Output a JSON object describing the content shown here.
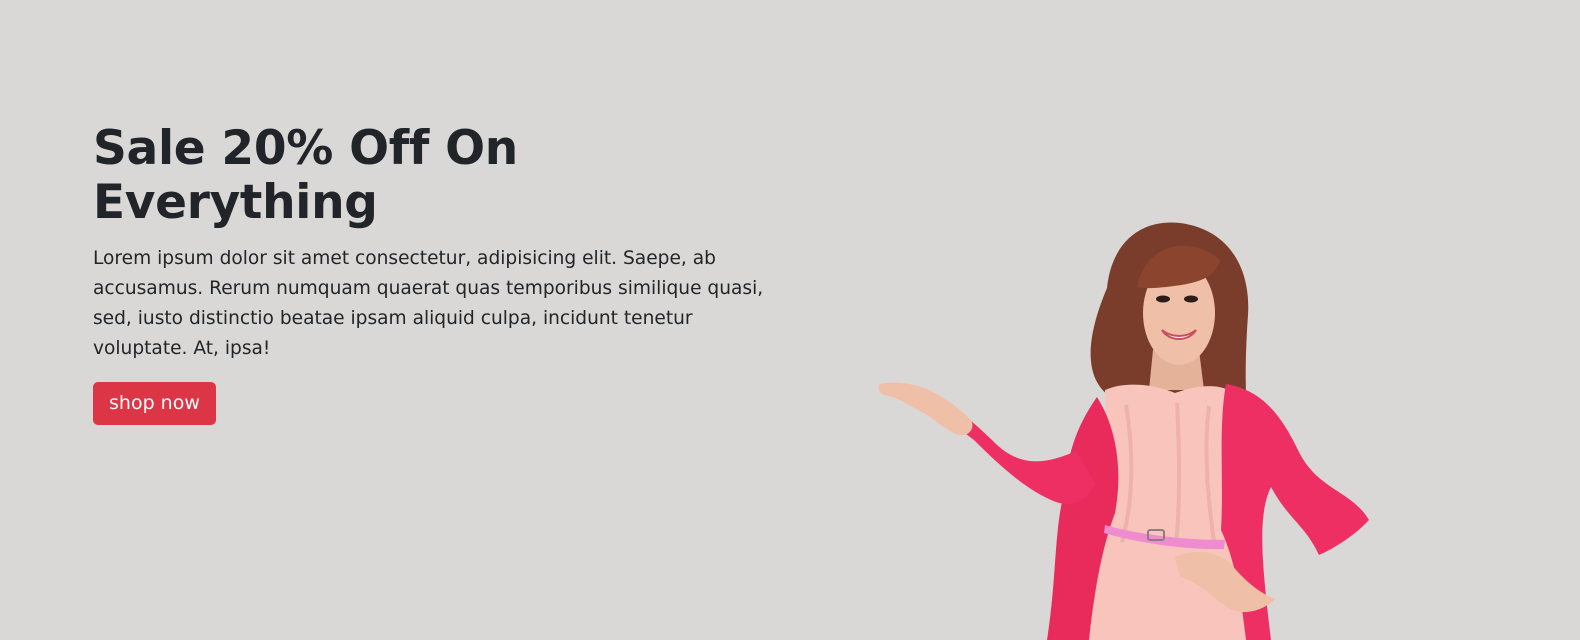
{
  "hero": {
    "title": "Sale 20% Off On Everything",
    "description": "Lorem ipsum dolor sit amet consectetur, adipisicing elit. Saepe, ab accusamus. Rerum numquam quaerat quas temporibus similique quasi, sed, iusto distinctio beatae ipsam aliquid culpa, incidunt tenetur voluptate. At, ipsa!",
    "button_label": "shop now",
    "colors": {
      "background": "#d9d8d6",
      "button": "#dc3545",
      "text": "#212529",
      "cardigan": "#ee2f63",
      "dress": "#f9c4bc",
      "belt": "#ef8ccf",
      "hair": "#7b3d2b"
    },
    "image_icon": "woman-pointing-image"
  }
}
